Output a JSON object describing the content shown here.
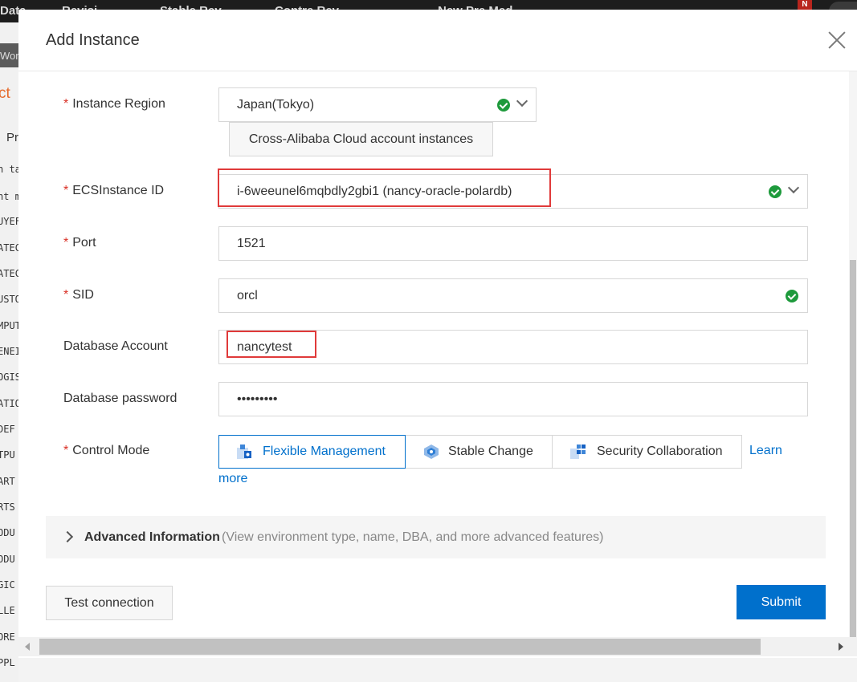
{
  "background": {
    "top_bar_items": [
      "Data",
      "Revisi..",
      "Stable Rev..",
      "Contre Rev..",
      "New Pre Med.."
    ],
    "badge": "N",
    "left_panel_title": "Worl",
    "left_orange_text": "ct",
    "left_tab_label": "Pr",
    "left_rows": [
      "n tab",
      "nt m",
      "UYEF",
      "ATEC",
      "ATEC",
      "USTO",
      "MPUT",
      "ENEI",
      "OGIS",
      "ATIO",
      "DEF",
      "TPU",
      "ART",
      "RTS",
      "ODU",
      "ODU",
      "GIC",
      "LLE",
      "ORE",
      "PPL"
    ]
  },
  "dialog": {
    "title": "Add Instance",
    "form": {
      "instance_region": {
        "label": "Instance Region",
        "required": "*",
        "value": "Japan(Tokyo)",
        "cross_account_button": "Cross-Alibaba Cloud account instances"
      },
      "ecs_instance_id": {
        "label": "ECSInstance ID",
        "required": "*",
        "value": "i-6weeunel6mqbdly2gbi1  (nancy-oracle-polardb)"
      },
      "port": {
        "label": "Port",
        "required": "*",
        "value": "1521"
      },
      "sid": {
        "label": "SID",
        "required": "*",
        "value": "orcl"
      },
      "database_account": {
        "label": "Database Account",
        "value": "nancytest"
      },
      "database_password": {
        "label": "Database password",
        "value": "•••••••••"
      },
      "control_mode": {
        "label": "Control Mode",
        "required": "*",
        "options": [
          {
            "label": "Flexible Management",
            "icon": "flexible-management-icon",
            "selected": true
          },
          {
            "label": "Stable Change",
            "icon": "stable-change-icon",
            "selected": false
          },
          {
            "label": "Security Collaboration",
            "icon": "security-collaboration-icon",
            "selected": false
          }
        ],
        "learn_more_part1": "Learn",
        "learn_more_part2": "more"
      }
    },
    "advanced": {
      "title": "Advanced Information",
      "description": "(View environment type, name, DBA, and more advanced features)"
    },
    "buttons": {
      "test_connection": "Test connection",
      "submit": "Submit"
    }
  },
  "colors": {
    "primary": "#0070cc",
    "required": "#d93026",
    "success": "#1e9a3c",
    "highlight": "#e03a3a"
  }
}
